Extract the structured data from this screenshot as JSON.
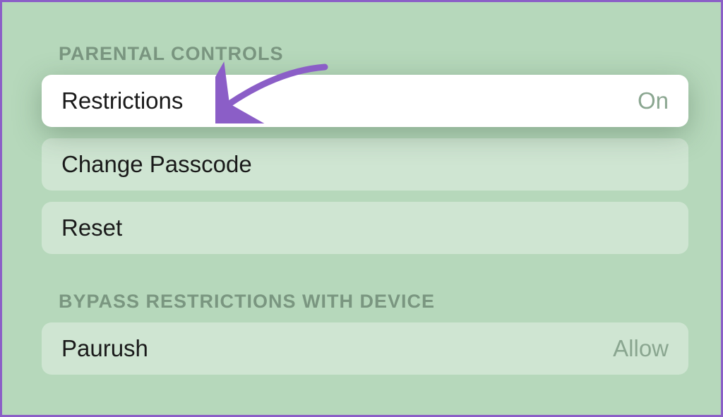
{
  "sections": {
    "parental_controls": {
      "header": "PARENTAL CONTROLS",
      "restrictions": {
        "label": "Restrictions",
        "value": "On"
      },
      "change_passcode": {
        "label": "Change Passcode"
      },
      "reset": {
        "label": "Reset"
      }
    },
    "bypass": {
      "header": "BYPASS RESTRICTIONS WITH DEVICE",
      "device": {
        "label": "Paurush",
        "value": "Allow"
      }
    }
  },
  "annotation": {
    "arrow_color": "#8b5ec7"
  }
}
